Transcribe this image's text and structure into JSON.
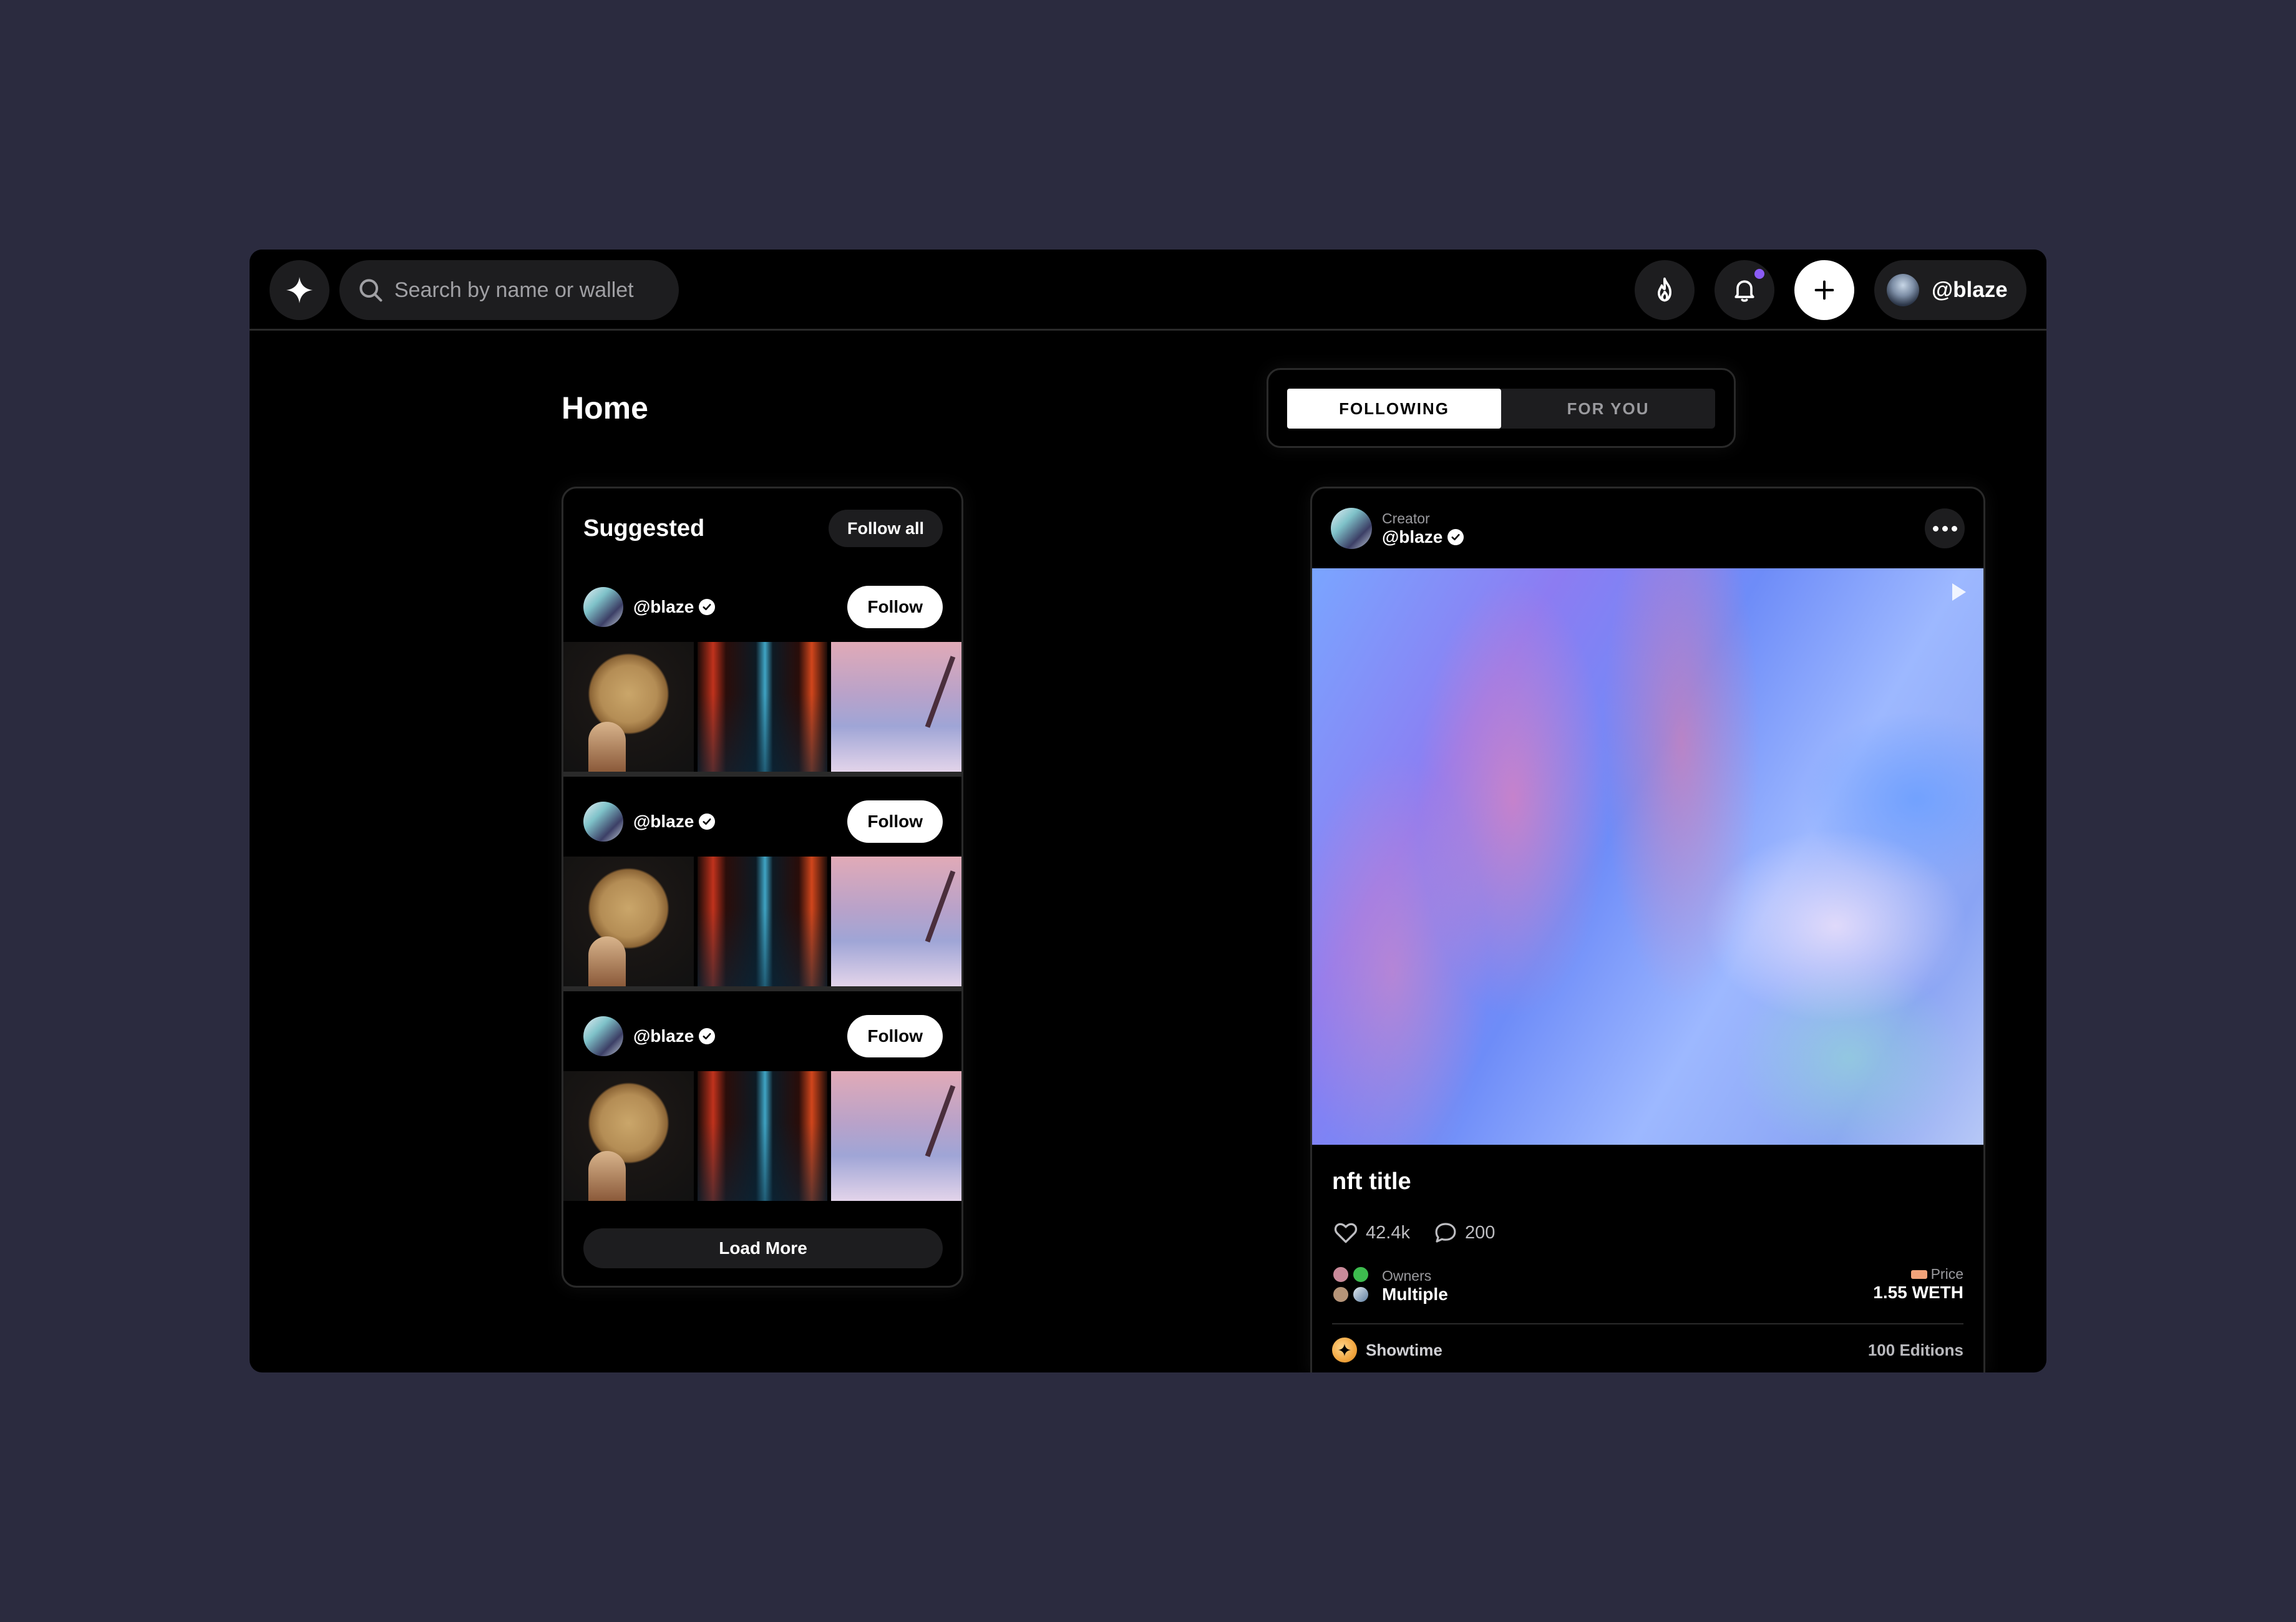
{
  "topbar": {
    "search_placeholder": "Search by name or wallet",
    "profile_handle": "@blaze",
    "notification_dot_color": "#8b5cf6"
  },
  "page": {
    "title": "Home",
    "tabs": [
      {
        "label": "FOLLOWING",
        "active": true
      },
      {
        "label": "FOR YOU",
        "active": false
      }
    ]
  },
  "suggested": {
    "title": "Suggested",
    "follow_all_label": "Follow all",
    "users": [
      {
        "handle": "@blaze",
        "follow_label": "Follow",
        "verified": true
      },
      {
        "handle": "@blaze",
        "follow_label": "Follow",
        "verified": true
      },
      {
        "handle": "@blaze",
        "follow_label": "Follow",
        "verified": true
      }
    ],
    "load_more_label": "Load More"
  },
  "post": {
    "creator_label": "Creator",
    "creator_handle": "@blaze",
    "title": "nft title",
    "likes": "42.4k",
    "comments": "200",
    "owners_label": "Owners",
    "owners_value": "Multiple",
    "price_label": "Price",
    "price_value": "1.55 WETH",
    "platform": "Showtime",
    "editions": "100 Editions"
  },
  "icons": [
    "sparkle-logo-icon",
    "search-icon",
    "flame-icon",
    "bell-icon",
    "plus-icon",
    "verified-icon",
    "more-icon",
    "heart-icon",
    "comment-icon",
    "price-tag-icon"
  ]
}
